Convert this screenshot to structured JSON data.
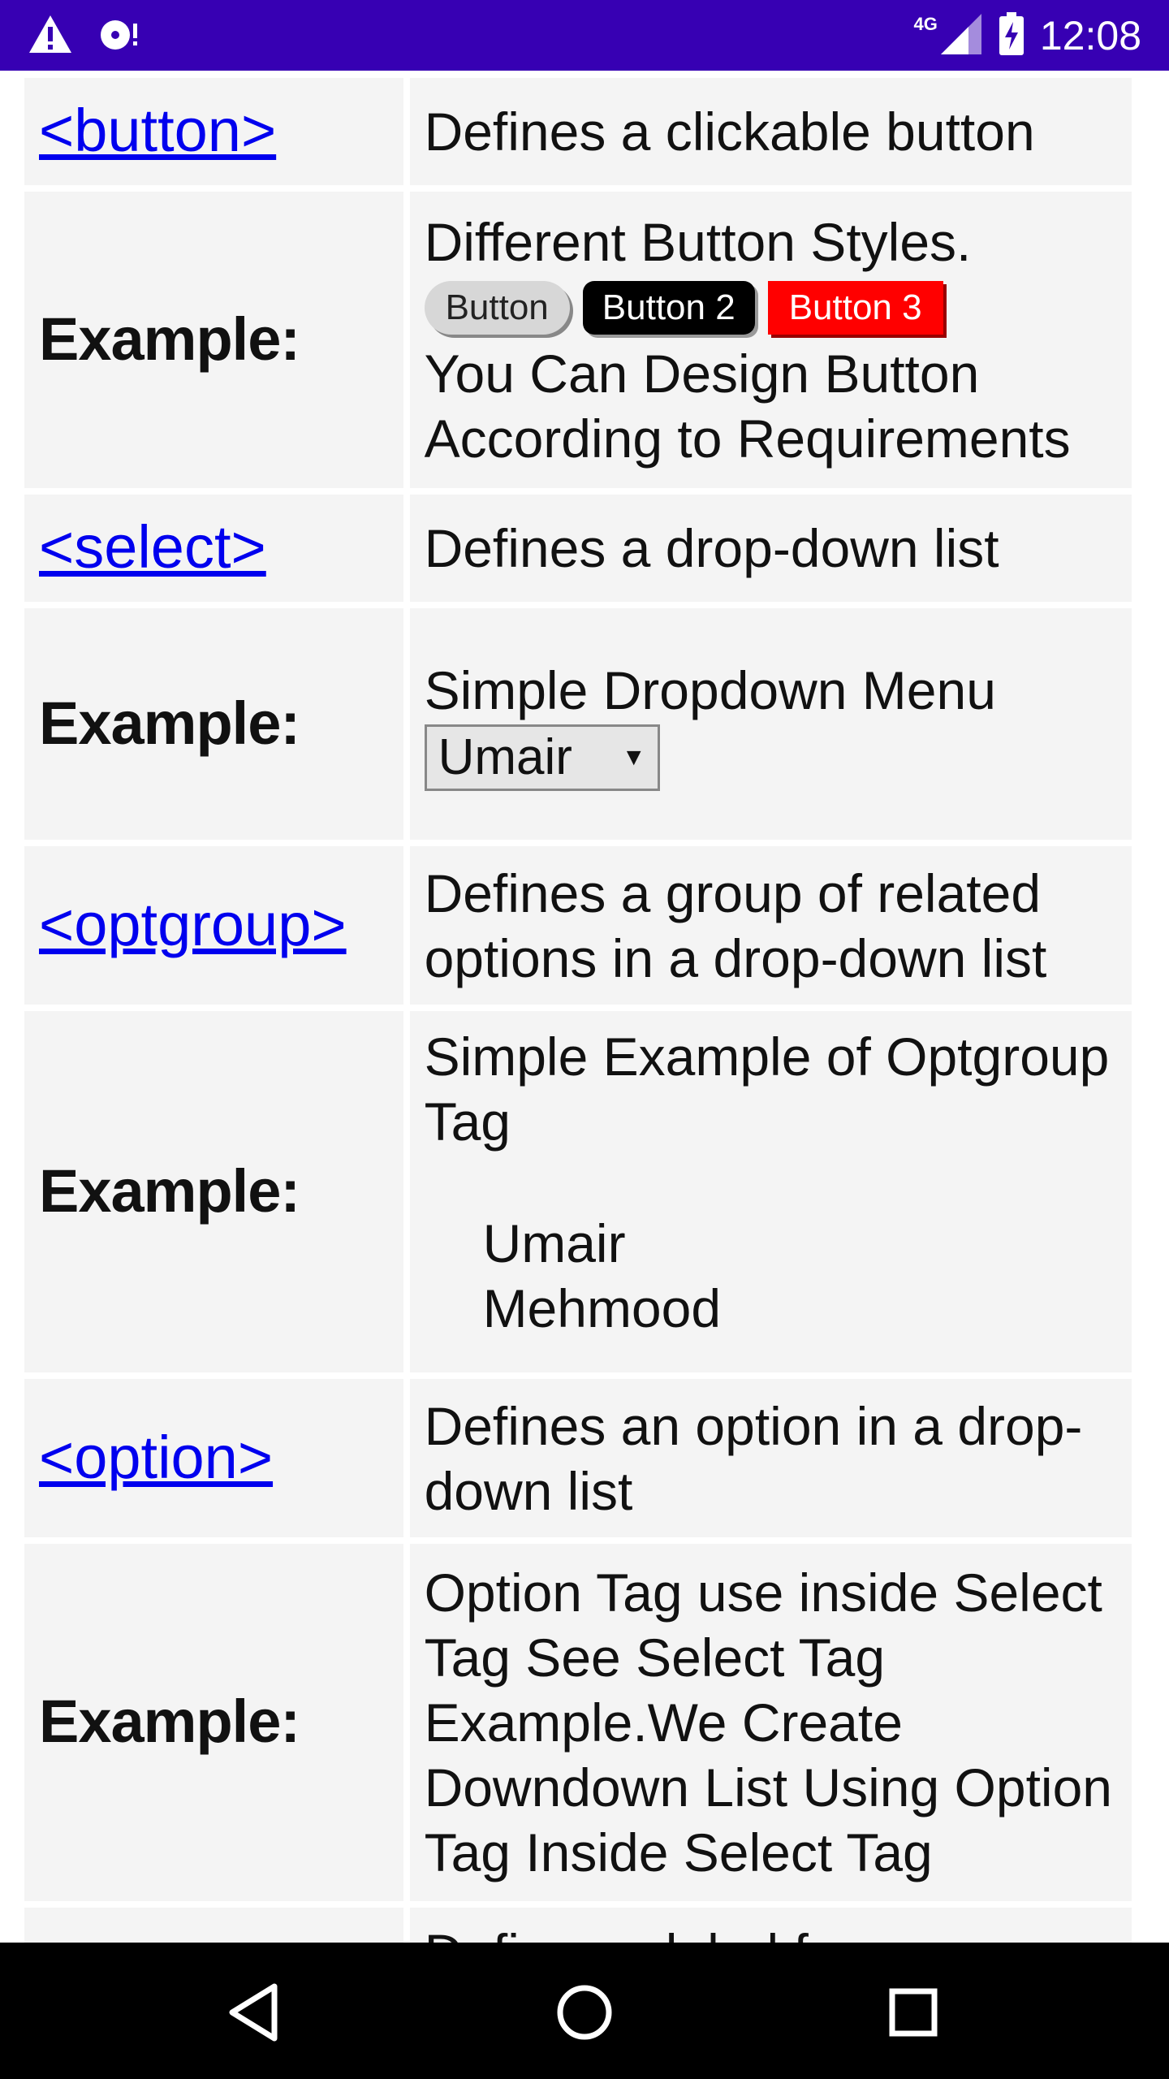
{
  "status_bar": {
    "time": "12:08",
    "network": "4G",
    "icons": [
      "warning-icon",
      "media-icon",
      "signal-icon",
      "battery-charging-icon"
    ]
  },
  "rows": [
    {
      "tag": "<button>",
      "desc": "Defines a clickable button"
    },
    {
      "example_label": "Example:",
      "intro": "Different Button Styles.",
      "buttons": [
        "Button",
        "Button 2",
        "Button 3"
      ],
      "outro": "You Can Design Button According to Requirements"
    },
    {
      "tag": "<select>",
      "desc": "Defines a drop-down list"
    },
    {
      "example_label": "Example:",
      "intro": "Simple Dropdown Menu",
      "select_value": "Umair"
    },
    {
      "tag": "<optgroup>",
      "desc": "Defines a group of related options in a drop-down list"
    },
    {
      "example_label": "Example:",
      "intro": "Simple Example of Optgroup Tag",
      "options": [
        "Umair",
        "Mehmood"
      ]
    },
    {
      "tag": "<option>",
      "desc": "Defines an option in a drop-down list"
    },
    {
      "example_label": "Example:",
      "text": "Option Tag use inside Select Tag See Select Tag Example.We Create Downdown List Using Option Tag Inside Select Tag"
    },
    {
      "tag": "",
      "desc": "Defines a label for an <input>"
    }
  ],
  "nav_bar": {
    "icons": [
      "back-icon",
      "home-icon",
      "recents-icon"
    ]
  }
}
